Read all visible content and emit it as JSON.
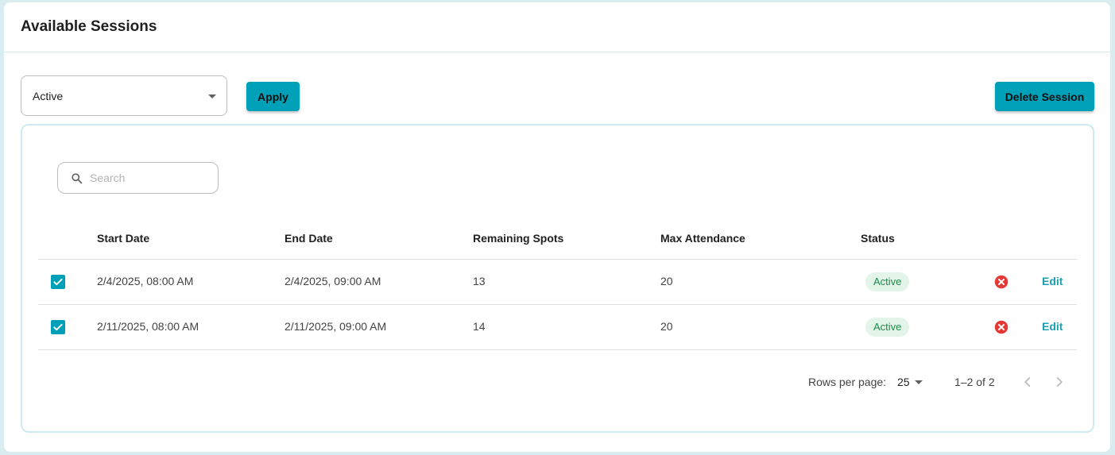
{
  "header": {
    "title": "Available Sessions"
  },
  "filter": {
    "selected": "Active",
    "apply_label": "Apply",
    "delete_label": "Delete Session"
  },
  "search": {
    "placeholder": "Search",
    "value": ""
  },
  "table": {
    "columns": [
      "Start Date",
      "End Date",
      "Remaining Spots",
      "Max Attendance",
      "Status"
    ],
    "rows": [
      {
        "checked": true,
        "start_date": "2/4/2025, 08:00 AM",
        "end_date": "2/4/2025, 09:00 AM",
        "remaining_spots": "13",
        "max_attendance": "20",
        "status": "Active",
        "edit_label": "Edit"
      },
      {
        "checked": true,
        "start_date": "2/11/2025, 08:00 AM",
        "end_date": "2/11/2025, 09:00 AM",
        "remaining_spots": "14",
        "max_attendance": "20",
        "status": "Active",
        "edit_label": "Edit"
      }
    ]
  },
  "pagination": {
    "rows_per_page_label": "Rows per page:",
    "rows_per_page": "25",
    "range": "1–2 of 2"
  },
  "colors": {
    "accent": "#00a0b8",
    "status_active_text": "#1f8a4c",
    "status_active_bg": "#e3f4e8",
    "cancel": "#e53935",
    "link": "#1a9fb5"
  },
  "icons": {
    "dropdown": "chevron-down-icon",
    "search": "search-icon",
    "checkbox": "check-icon",
    "cancel": "cancel-icon",
    "prev": "chevron-left-icon",
    "next": "chevron-right-icon"
  }
}
